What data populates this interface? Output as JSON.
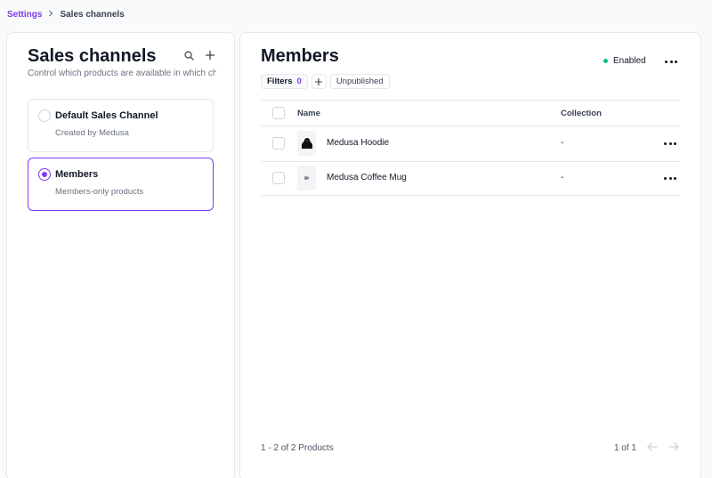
{
  "breadcrumb": {
    "parent": "Settings",
    "current": "Sales channels"
  },
  "sales_channels": {
    "title": "Sales channels",
    "subtitle": "Control which products are available in which ch...",
    "icons": [
      "search-icon",
      "plus-icon"
    ],
    "channels": [
      {
        "name": "Default Sales Channel",
        "description": "Created by Medusa",
        "selected": false
      },
      {
        "name": "Members",
        "description": "Members-only products",
        "selected": true
      }
    ]
  },
  "members": {
    "title": "Members",
    "status": "Enabled",
    "status_color": "#10b981",
    "filters": {
      "label": "Filters",
      "count": "0",
      "add_icon": "plus-icon",
      "chips": [
        "Unpublished"
      ]
    },
    "table": {
      "columns": {
        "name": "Name",
        "collection": "Collection"
      },
      "rows": [
        {
          "name": "Medusa Hoodie",
          "collection": "-",
          "thumb_icon": "hoodie-icon"
        },
        {
          "name": "Medusa Coffee Mug",
          "collection": "-",
          "thumb_icon": "mug-icon"
        }
      ]
    },
    "footer": {
      "count_text": "1 - 2 of 2 Products",
      "page_text": "1 of 1"
    }
  },
  "accent_color": "#7c3aed"
}
